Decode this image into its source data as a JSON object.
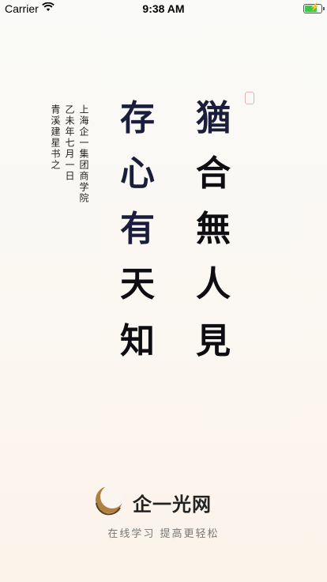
{
  "status_bar": {
    "carrier": "Carrier",
    "time": "9:38 AM",
    "battery_level": 0.85
  },
  "calligraphy": {
    "right_column": [
      "猶",
      "合",
      "無",
      "人",
      "見"
    ],
    "left_column": [
      "存",
      "心",
      "有",
      "天",
      "知"
    ],
    "inscription_lines": [
      "上海企一集团商学院",
      "乙未年七月一日",
      "青溪建星书之"
    ]
  },
  "brand": {
    "name": "企一光网",
    "slogan": "在线学习 提高更轻松",
    "accent_color": "#8a6a3a"
  }
}
